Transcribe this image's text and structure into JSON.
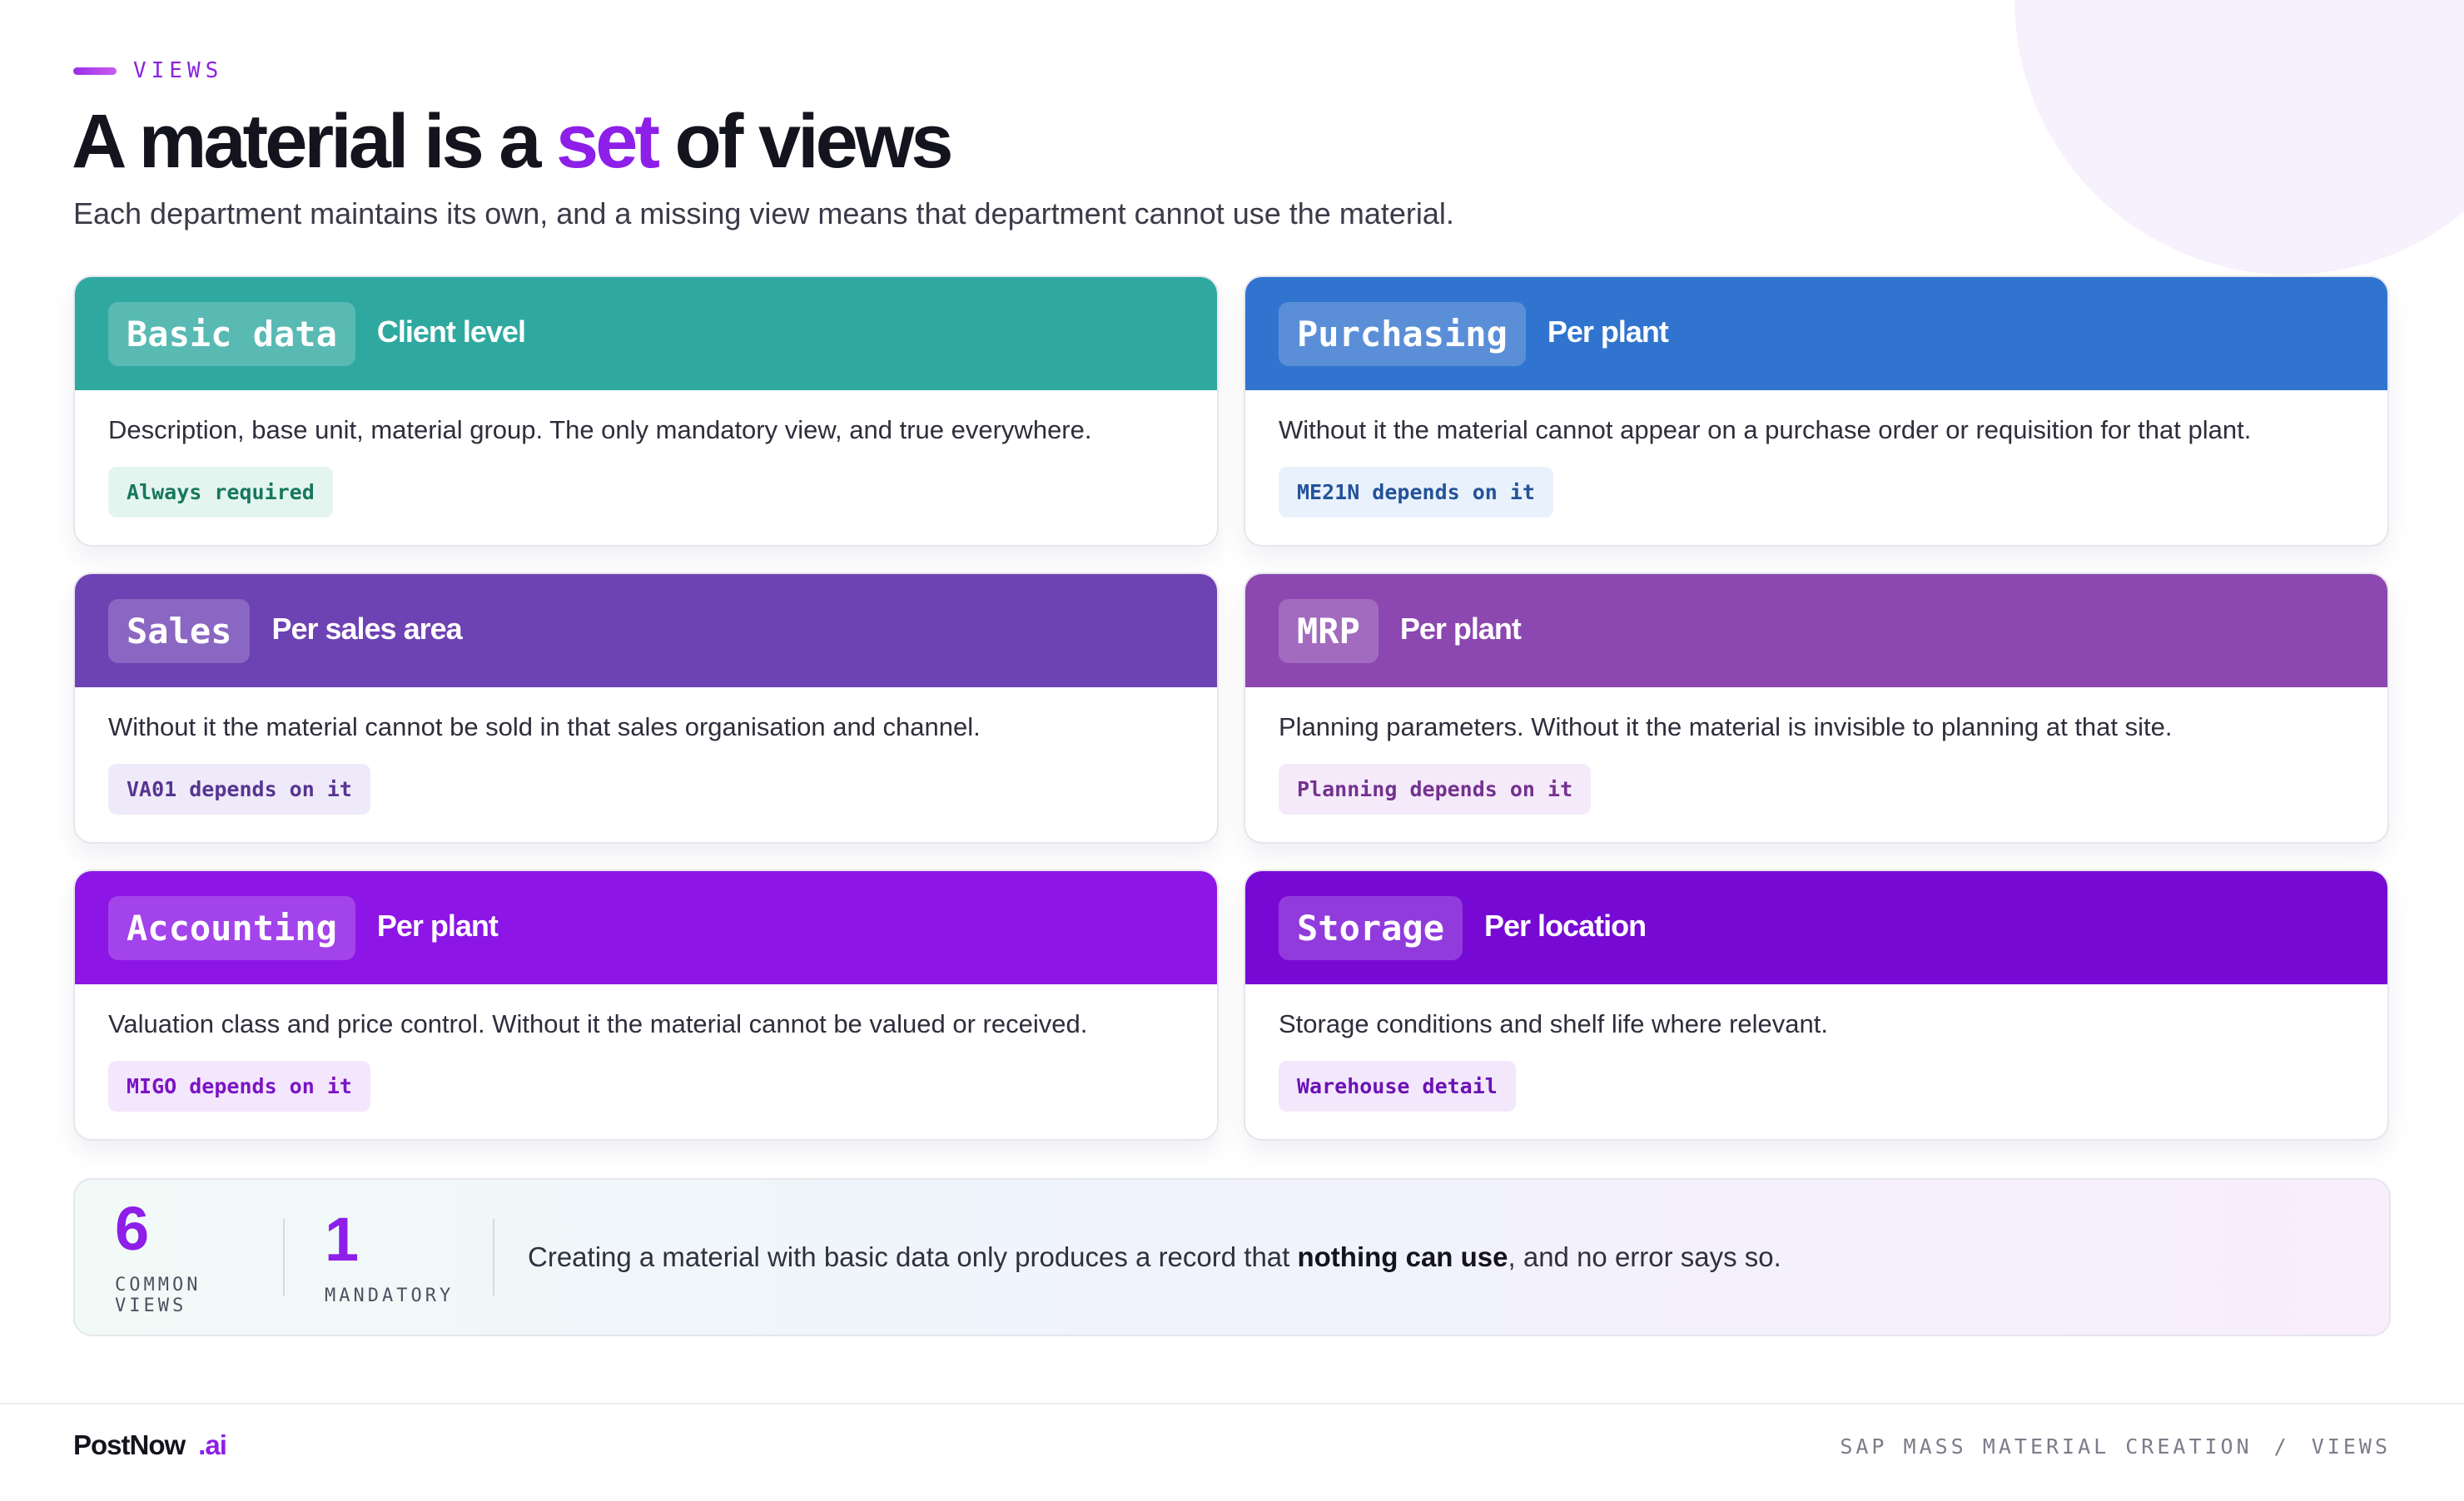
{
  "eyebrow": "VIEWS",
  "title": {
    "pre": "A material is a ",
    "accent": "set",
    "post": " of views"
  },
  "subtitle": "Each department maintains its own, and a missing view means that department cannot use the material.",
  "cards": [
    {
      "name": "Basic data",
      "scope": "Client level",
      "description": "Description, base unit, material group. The only mandatory view, and true everywhere.",
      "tag": "Always required",
      "header_color": "#2fa9a0",
      "tag_bg": "#e4f5ef",
      "tag_color": "#16785c"
    },
    {
      "name": "Purchasing",
      "scope": "Per plant",
      "description": "Without it the material cannot appear on a purchase order or requisition for that plant.",
      "tag": "ME21N depends on it",
      "header_color": "#3174cf",
      "tag_bg": "#e9f1fc",
      "tag_color": "#24529a"
    },
    {
      "name": "Sales",
      "scope": "Per sales area",
      "description": "Without it the material cannot be sold in that sales organisation and channel.",
      "tag": "VA01 depends on it",
      "header_color": "#6d42b3",
      "tag_bg": "#efeaf9",
      "tag_color": "#573592"
    },
    {
      "name": "MRP",
      "scope": "Per plant",
      "description": "Planning parameters. Without it the material is invisible to planning at that site.",
      "tag": "Planning depends on it",
      "header_color": "#8c47b0",
      "tag_bg": "#f5eafa",
      "tag_color": "#74328f"
    },
    {
      "name": "Accounting",
      "scope": "Per plant",
      "description": "Valuation class and price control. Without it the material cannot be valued or received.",
      "tag": "MIGO depends on it",
      "header_color": "#8d15e6",
      "tag_bg": "#f4e6fc",
      "tag_color": "#7a14c4"
    },
    {
      "name": "Storage",
      "scope": "Per location",
      "description": "Storage conditions and shelf life where relevant.",
      "tag": "Warehouse detail",
      "header_color": "#760ad4",
      "tag_bg": "#f3e7fb",
      "tag_color": "#6a12b5"
    }
  ],
  "stats": {
    "items": [
      {
        "value": "6",
        "label": "COMMON VIEWS"
      },
      {
        "value": "1",
        "label": "MANDATORY"
      }
    ],
    "message_pre": "Creating a material with basic data only produces a record that ",
    "message_bold": "nothing can use",
    "message_post": ", and no error says so."
  },
  "footer": {
    "brand_name": "PostNow",
    "brand_suffix": ".ai",
    "crumb_1": "SAP MASS MATERIAL CREATION",
    "crumb_sep": "/",
    "crumb_2": "VIEWS"
  }
}
